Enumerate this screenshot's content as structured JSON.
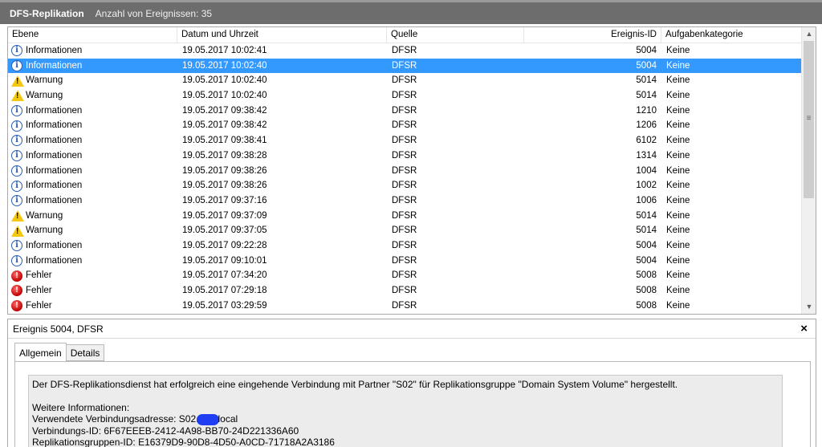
{
  "title_bar": {
    "app_name": "DFS-Replikation",
    "event_count": "Anzahl von Ereignissen: 35"
  },
  "table": {
    "columns": [
      "Ebene",
      "Datum und Uhrzeit",
      "Quelle",
      "Ereignis-ID",
      "Aufgabenkategorie"
    ],
    "rows": [
      {
        "level": "Informationen",
        "icon": "info-icon",
        "datetime": "19.05.2017 10:02:41",
        "source": "DFSR",
        "event_id": "5004",
        "category": "Keine"
      },
      {
        "level": "Informationen",
        "icon": "info-icon",
        "datetime": "19.05.2017 10:02:40",
        "source": "DFSR",
        "event_id": "5004",
        "category": "Keine",
        "selected": true
      },
      {
        "level": "Warnung",
        "icon": "warning-icon",
        "datetime": "19.05.2017 10:02:40",
        "source": "DFSR",
        "event_id": "5014",
        "category": "Keine"
      },
      {
        "level": "Warnung",
        "icon": "warning-icon",
        "datetime": "19.05.2017 10:02:40",
        "source": "DFSR",
        "event_id": "5014",
        "category": "Keine"
      },
      {
        "level": "Informationen",
        "icon": "info-icon",
        "datetime": "19.05.2017 09:38:42",
        "source": "DFSR",
        "event_id": "1210",
        "category": "Keine"
      },
      {
        "level": "Informationen",
        "icon": "info-icon",
        "datetime": "19.05.2017 09:38:42",
        "source": "DFSR",
        "event_id": "1206",
        "category": "Keine"
      },
      {
        "level": "Informationen",
        "icon": "info-icon",
        "datetime": "19.05.2017 09:38:41",
        "source": "DFSR",
        "event_id": "6102",
        "category": "Keine"
      },
      {
        "level": "Informationen",
        "icon": "info-icon",
        "datetime": "19.05.2017 09:38:28",
        "source": "DFSR",
        "event_id": "1314",
        "category": "Keine"
      },
      {
        "level": "Informationen",
        "icon": "info-icon",
        "datetime": "19.05.2017 09:38:26",
        "source": "DFSR",
        "event_id": "1004",
        "category": "Keine"
      },
      {
        "level": "Informationen",
        "icon": "info-icon",
        "datetime": "19.05.2017 09:38:26",
        "source": "DFSR",
        "event_id": "1002",
        "category": "Keine"
      },
      {
        "level": "Informationen",
        "icon": "info-icon",
        "datetime": "19.05.2017 09:37:16",
        "source": "DFSR",
        "event_id": "1006",
        "category": "Keine"
      },
      {
        "level": "Warnung",
        "icon": "warning-icon",
        "datetime": "19.05.2017 09:37:09",
        "source": "DFSR",
        "event_id": "5014",
        "category": "Keine"
      },
      {
        "level": "Warnung",
        "icon": "warning-icon",
        "datetime": "19.05.2017 09:37:05",
        "source": "DFSR",
        "event_id": "5014",
        "category": "Keine"
      },
      {
        "level": "Informationen",
        "icon": "info-icon",
        "datetime": "19.05.2017 09:22:28",
        "source": "DFSR",
        "event_id": "5004",
        "category": "Keine"
      },
      {
        "level": "Informationen",
        "icon": "info-icon",
        "datetime": "19.05.2017 09:10:01",
        "source": "DFSR",
        "event_id": "5004",
        "category": "Keine"
      },
      {
        "level": "Fehler",
        "icon": "error-icon",
        "datetime": "19.05.2017 07:34:20",
        "source": "DFSR",
        "event_id": "5008",
        "category": "Keine"
      },
      {
        "level": "Fehler",
        "icon": "error-icon",
        "datetime": "19.05.2017 07:29:18",
        "source": "DFSR",
        "event_id": "5008",
        "category": "Keine"
      },
      {
        "level": "Fehler",
        "icon": "error-icon",
        "datetime": "19.05.2017 03:29:59",
        "source": "DFSR",
        "event_id": "5008",
        "category": "Keine"
      }
    ]
  },
  "details": {
    "header": "Ereignis 5004, DFSR",
    "close_label": "×",
    "tabs": [
      "Allgemein",
      "Details"
    ],
    "message": "Der DFS-Replikationsdienst hat erfolgreich eine eingehende Verbindung mit Partner \"S02\" für Replikationsgruppe \"Domain System Volume\" hergestellt.",
    "more_info_label": "Weitere Informationen:",
    "connection_address_prefix": "Verwendete Verbindungsadresse: S02.",
    "connection_address_suffix": "local",
    "connection_id": "Verbindungs-ID: 6F67EEEB-2412-4A98-BB70-24D221336A60",
    "replication_group_id": "Replikationsgruppen-ID: E16379D9-90D8-4D50-A0CD-71718A2A3186"
  },
  "colors": {
    "selection": "#3399ff",
    "title_bar": "#6d6d6d",
    "redaction": "#1f3df2"
  }
}
